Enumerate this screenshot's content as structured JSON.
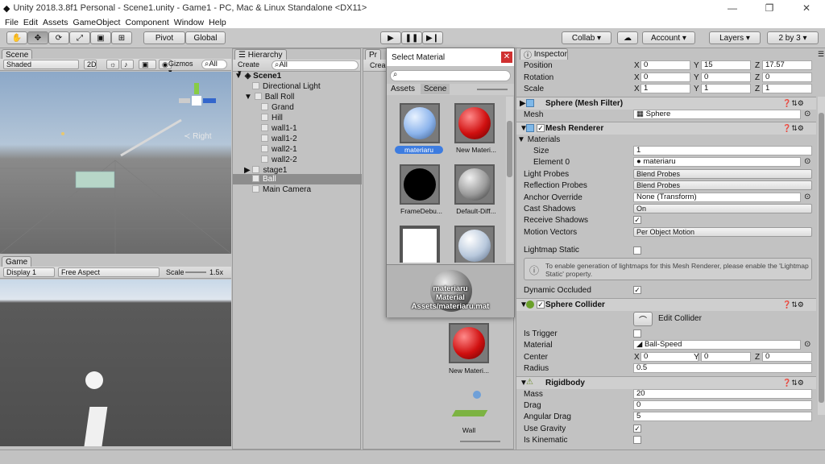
{
  "window": {
    "title": "Unity 2018.3.8f1 Personal - Scene1.unity - Game1 - PC, Mac & Linux Standalone <DX11>",
    "min": "—",
    "max": "❐",
    "close": "✕"
  },
  "menu": [
    "File",
    "Edit",
    "Assets",
    "GameObject",
    "Component",
    "Window",
    "Help"
  ],
  "toolbar": {
    "pivot": "Pivot",
    "global": "Global",
    "collab": "Collab ▾",
    "account": "Account",
    "layers": "Layers",
    "layout": "2 by 3"
  },
  "scene": {
    "tab": "Scene",
    "shading": "Shaded",
    "mode2d": "2D",
    "gizmos": "Gizmos ▾",
    "search": "All",
    "axis_label": "≺ Right"
  },
  "game": {
    "tab": "Game",
    "display": "Display 1",
    "aspect": "Free Aspect",
    "scale_label": "Scale",
    "scale_value": "1.5x"
  },
  "hierarchy": {
    "tab": "Hierarchy",
    "create": "Create ▾",
    "search": "All",
    "scene": "Scene1",
    "items": [
      "Directional Light",
      "Ball Roll",
      "Grand",
      "Hill",
      "wall1-1",
      "wall1-2",
      "wall2-1",
      "wall2-2",
      "stage1",
      "Ball",
      "Main Camera"
    ]
  },
  "project": {
    "tab": "Pr",
    "create": "Crea",
    "mat_caption": "New Materi...",
    "wall_caption": "Wall"
  },
  "select_material": {
    "title": "Select Material",
    "tabs": [
      "Assets",
      "Scene"
    ],
    "items": [
      "materiaru",
      "New Materi...",
      "FrameDebu...",
      "Default-Diff..."
    ],
    "preview_name": "materiaru",
    "preview_type": "Material",
    "preview_path": "Assets/materiaru.mat"
  },
  "inspector": {
    "tab": "Inspector",
    "transform": {
      "position": {
        "label": "Position",
        "x": "0",
        "y": "15",
        "z": "17.57"
      },
      "rotation": {
        "label": "Rotation",
        "x": "0",
        "y": "0",
        "z": "0"
      },
      "scale": {
        "label": "Scale",
        "x": "1",
        "y": "1",
        "z": "1"
      }
    },
    "mesh_filter": {
      "title": "Sphere (Mesh Filter)",
      "mesh_label": "Mesh",
      "mesh_value": "Sphere"
    },
    "mesh_renderer": {
      "title": "Mesh Renderer",
      "materials": "Materials",
      "size_label": "Size",
      "size": "1",
      "element0_label": "Element 0",
      "element0": "materiaru",
      "light_probes_label": "Light Probes",
      "light_probes": "Blend Probes",
      "reflection_label": "Reflection Probes",
      "reflection": "Blend Probes",
      "anchor_label": "Anchor Override",
      "anchor": "None (Transform)",
      "cast_label": "Cast Shadows",
      "cast": "On",
      "receive_label": "Receive Shadows",
      "motion_label": "Motion Vectors",
      "motion": "Per Object Motion",
      "lightmap_label": "Lightmap Static",
      "info": "To enable generation of lightmaps for this Mesh Renderer, please enable the 'Lightmap Static' property.",
      "occluded_label": "Dynamic Occluded"
    },
    "sphere_collider": {
      "title": "Sphere Collider",
      "edit": "Edit Collider",
      "trigger_label": "Is Trigger",
      "material_label": "Material",
      "material": "Ball-Speed",
      "center_label": "Center",
      "cx": "0",
      "cy": "0",
      "cz": "0",
      "radius_label": "Radius",
      "radius": "0.5"
    },
    "rigidbody": {
      "title": "Rigidbody",
      "mass_label": "Mass",
      "mass": "20",
      "drag_label": "Drag",
      "drag": "0",
      "angdrag_label": "Angular Drag",
      "angdrag": "5",
      "gravity_label": "Use Gravity",
      "kinematic_label": "Is Kinematic"
    }
  }
}
